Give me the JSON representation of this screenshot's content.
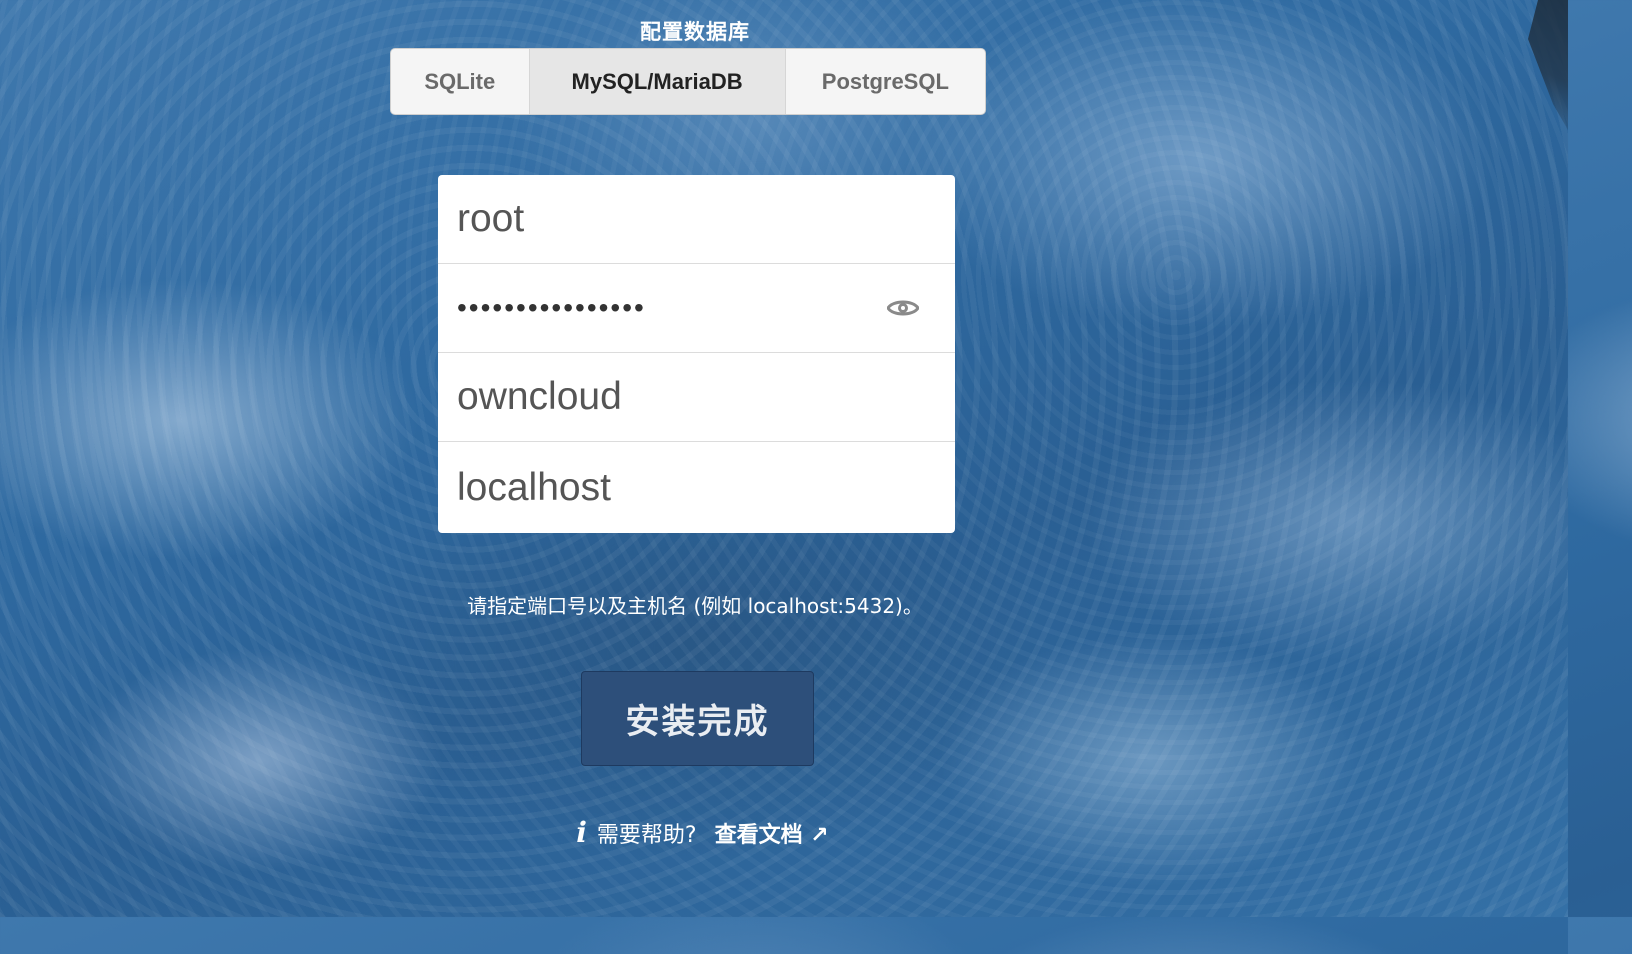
{
  "setup": {
    "db_heading": "配置数据库",
    "db_tabs": [
      {
        "label": "SQLite",
        "active": false
      },
      {
        "label": "MySQL/MariaDB",
        "active": true
      },
      {
        "label": "PostgreSQL",
        "active": false
      }
    ],
    "fields": {
      "db_user": "root",
      "db_password_mask": "••••••••••••••••",
      "db_name": "owncloud",
      "db_host": "localhost"
    },
    "hint": "请指定端口号以及主机名 (例如 localhost:5432)。",
    "install_button": "安装完成",
    "help_text": "需要帮助?",
    "docs_link": "查看文档 ↗",
    "info_icon_glyph": "i"
  },
  "icons": {
    "password_toggle": "eye-icon",
    "help": "info-icon"
  },
  "colors": {
    "button_bg": "#2d4f7a",
    "background_blue": "#2f6aa1"
  }
}
